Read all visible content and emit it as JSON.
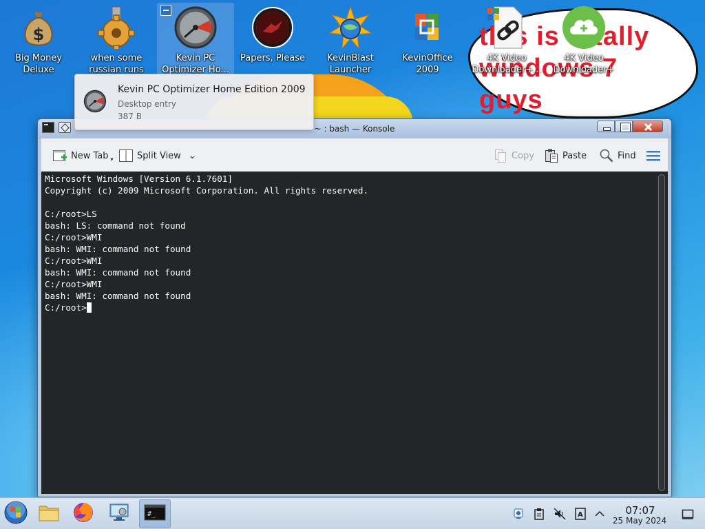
{
  "desktop": {
    "icons": [
      {
        "label": "Big Money Deluxe",
        "icon": "money-bag-icon"
      },
      {
        "label": "when some russian runs a...",
        "icon": "gear-icon"
      },
      {
        "label": "Kevin PC Optimizer Ho...",
        "icon": "gauge-icon"
      },
      {
        "label": "Papers, Please",
        "icon": "papers-please-icon"
      },
      {
        "label": "KevinBlast Launcher",
        "icon": "globe-burst-icon"
      },
      {
        "label": "KevinOffice 2009",
        "icon": "office-icon"
      },
      {
        "label": "4K Video Downloader+...",
        "icon": "link-document-icon"
      },
      {
        "label": "4K Video Downloader+",
        "icon": "cloud-download-icon"
      }
    ],
    "meme_text": "this is totally windows 7 guys"
  },
  "tooltip": {
    "title": "Kevin PC Optimizer Home Edition 2009",
    "type": "Desktop entry",
    "size": "387 B"
  },
  "window": {
    "title": "~ : bash — Konsole",
    "toolbar": {
      "new_tab": "New Tab",
      "split_view": "Split View",
      "copy": "Copy",
      "paste": "Paste",
      "find": "Find"
    },
    "terminal_lines": [
      "Microsoft Windows [Version 6.1.7601]",
      "Copyright (c) 2009 Microsoft Corporation. All rights reserved.",
      "",
      "C:/root>LS",
      "bash: LS: command not found",
      "C:/root>WMI",
      "bash: WMI: command not found",
      "C:/root>WMI",
      "bash: WMI: command not found",
      "C:/root>WMI",
      "bash: WMI: command not found"
    ],
    "prompt": "C:/root>"
  },
  "taskbar": {
    "items": [
      {
        "name": "start-button",
        "icon": "windows-orb-icon"
      },
      {
        "name": "file-manager",
        "icon": "folder-icon"
      },
      {
        "name": "firefox",
        "icon": "firefox-icon"
      },
      {
        "name": "system-settings",
        "icon": "computer-settings-icon"
      },
      {
        "name": "konsole",
        "icon": "terminal-icon",
        "active": true
      }
    ],
    "tray": [
      "display-icon",
      "clipboard-icon",
      "volume-muted-icon",
      "input-method-icon",
      "chevron-up-icon"
    ],
    "time": "07:07",
    "date": "25 May 2024"
  },
  "colors": {
    "terminal_bg": "#232627",
    "terminal_fg": "#fcfcfc",
    "meme_red": "#e01e2d",
    "accent": "#3daee9"
  }
}
